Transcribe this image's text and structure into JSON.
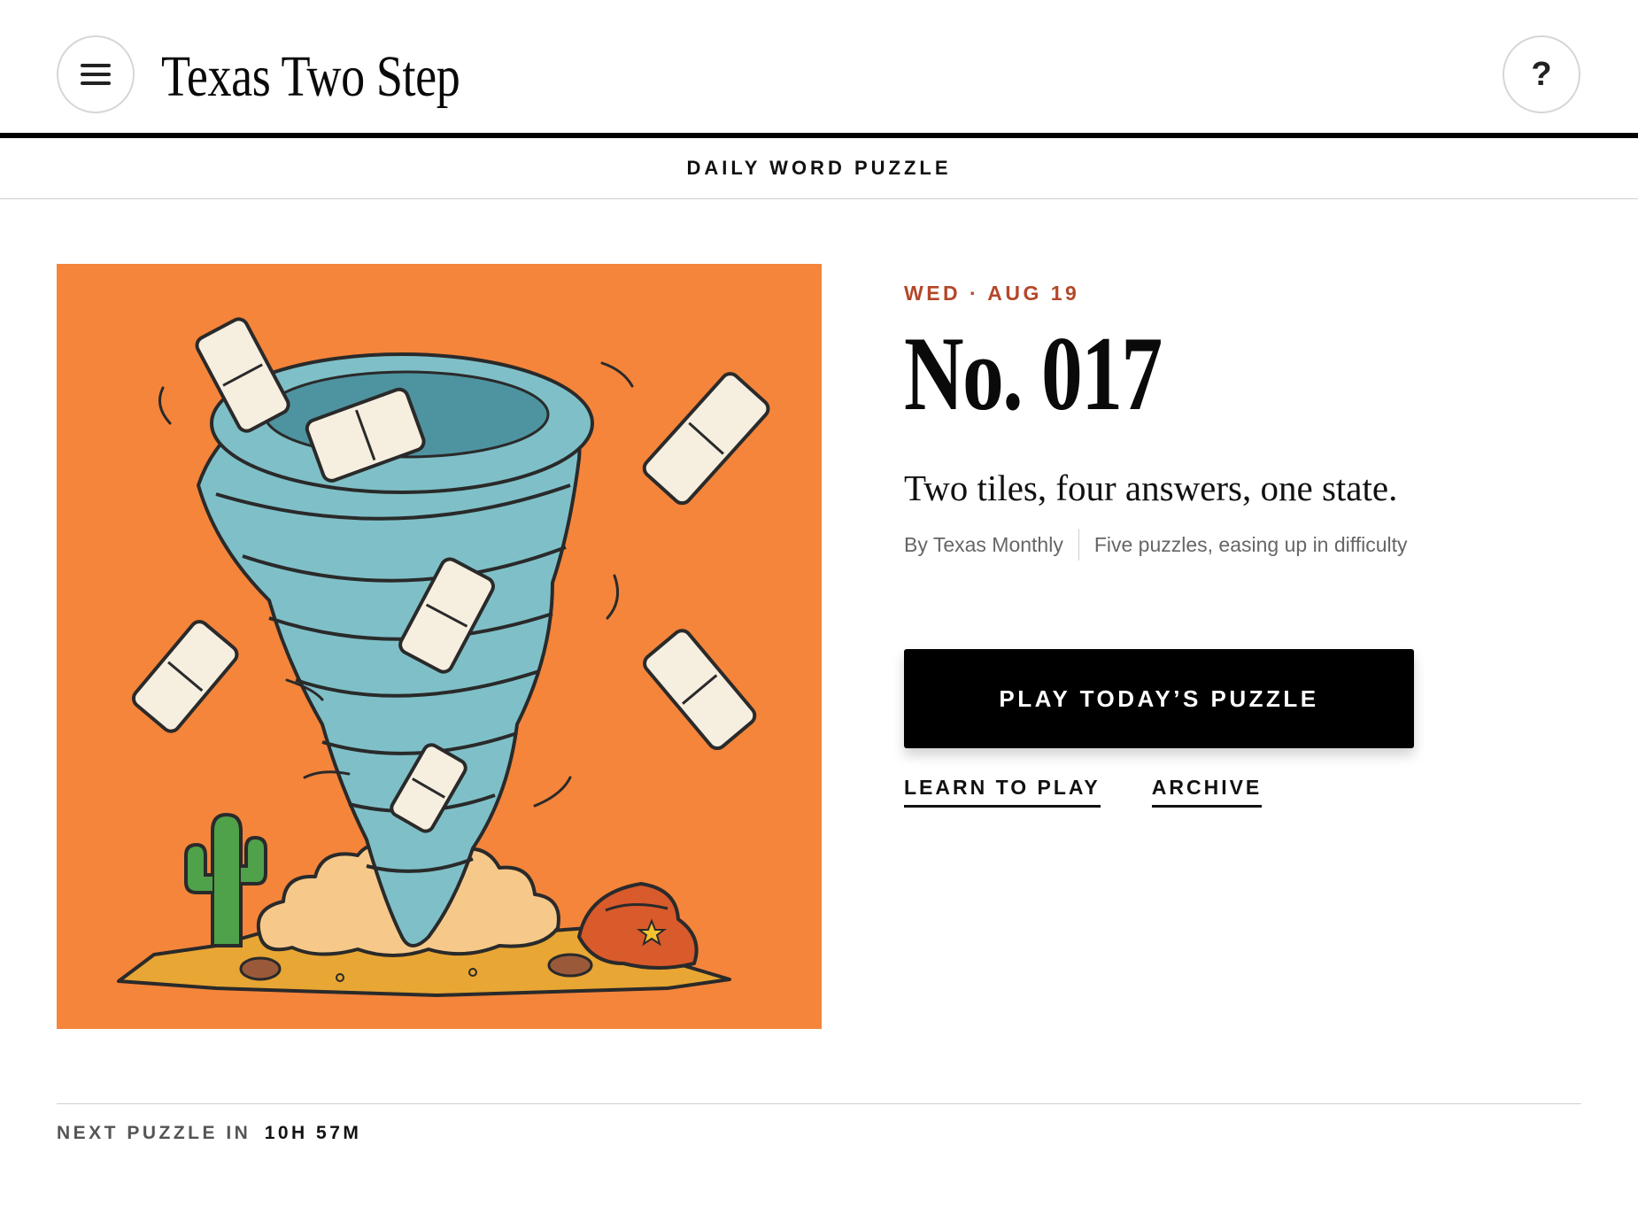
{
  "header": {
    "title": "Texas Two Step",
    "menu_icon": "menu-icon",
    "help_glyph": "?",
    "help_icon": "help-icon"
  },
  "subnav": {
    "label": "DAILY WORD PUZZLE"
  },
  "puzzle": {
    "date": "WED · AUG 19",
    "number": "No. 017",
    "tagline": "Two tiles, four answers, one state.",
    "byline": "By Texas Monthly",
    "difficulty_note": "Five puzzles, easing up in difficulty"
  },
  "actions": {
    "play_label": "PLAY TODAY’S PUZZLE",
    "learn_label": "LEARN TO PLAY",
    "archive_label": "ARCHIVE"
  },
  "footer": {
    "countdown_label": "NEXT PUZZLE IN",
    "countdown_value": "10H 57M"
  },
  "colors": {
    "accent": "#b4472a",
    "art_background": "#f4853b",
    "tornado": "#7fc0c8",
    "button": "#000000"
  },
  "illustration": {
    "subject": "tornado-with-domino-tiles",
    "elements": [
      "domino-tile",
      "cactus-icon",
      "cowboy-hat-icon",
      "dust-cloud",
      "desert-ground"
    ]
  }
}
